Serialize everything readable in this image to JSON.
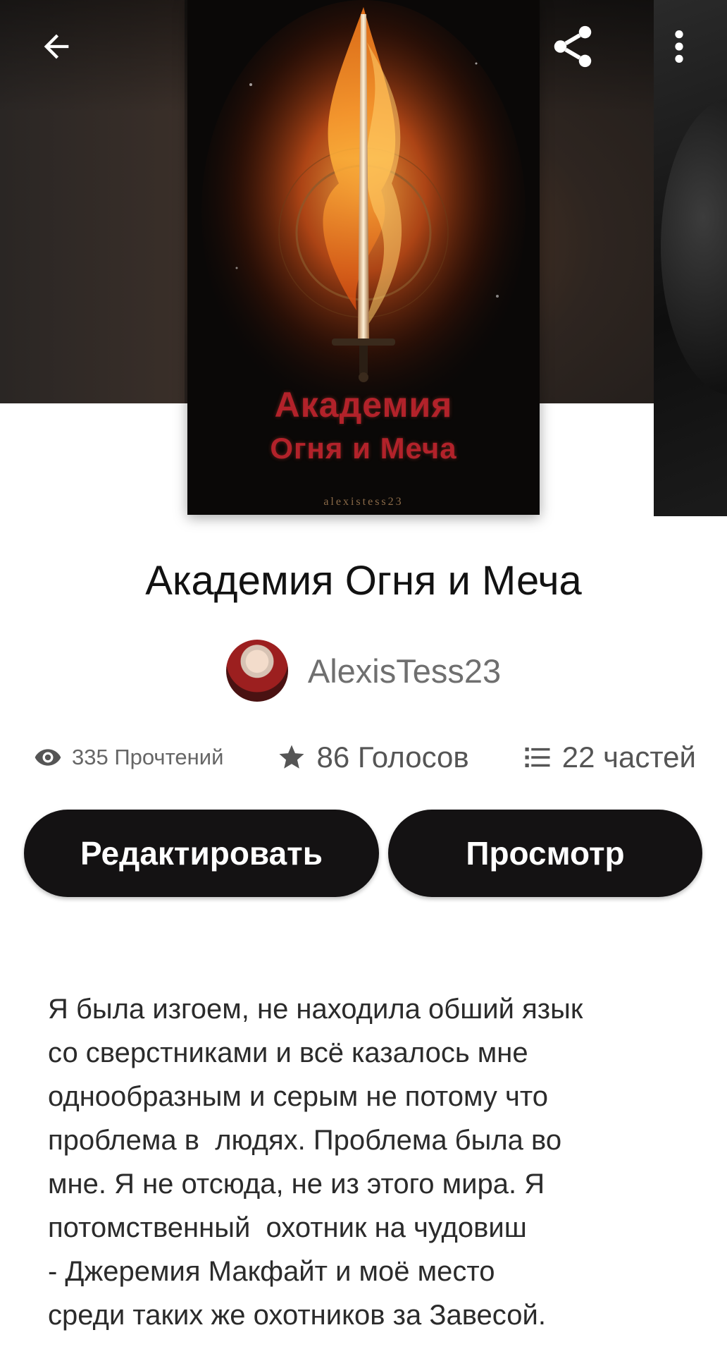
{
  "cover": {
    "title_line1": "Академия",
    "title_line2": "Огня и Меча",
    "author_mark": "alexistess23"
  },
  "story": {
    "title": "Академия Огня и Меча",
    "author": "AlexisTess23"
  },
  "stats": {
    "reads": "335 Прочтений",
    "votes": "86 Голосов",
    "parts": "22 частей"
  },
  "buttons": {
    "edit": "Редактировать",
    "view": "Просмотр"
  },
  "description": {
    "lines": [
      "Я была изгоем, не находила обший язык",
      "со сверстниками и всё казалось мне",
      "однообразным и серым не потому что",
      "проблема в  людях. Проблема была во",
      "мне. Я не отсюда, не из этого мира. Я",
      "потомственный  охотник на чудовиш",
      "- Джеремия Макфайт и моё место",
      "среди таких же охотников за Завесой."
    ]
  },
  "icons": {
    "back": "arrow-left-icon",
    "share": "share-icon",
    "more": "more-vertical-icon",
    "reads": "eye-icon",
    "votes": "star-icon",
    "parts": "list-icon"
  }
}
